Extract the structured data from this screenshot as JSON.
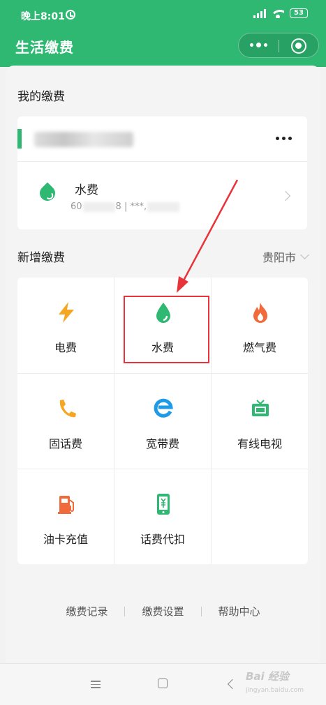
{
  "status_bar": {
    "time": "晚上8:01",
    "battery": "53"
  },
  "header": {
    "title": "生活缴费"
  },
  "my_bills": {
    "section_title": "我的缴费",
    "bill": {
      "title": "水费",
      "account_prefix": "60",
      "account_mid": "8 | ***,"
    }
  },
  "new_bills": {
    "section_title": "新增缴费",
    "city": "贵阳市",
    "items": [
      {
        "label": "电费",
        "icon": "lightning-icon",
        "color": "#f5a623"
      },
      {
        "label": "水费",
        "icon": "water-drop-icon",
        "color": "#2eb872"
      },
      {
        "label": "燃气费",
        "icon": "flame-icon",
        "color": "#f06a3b"
      },
      {
        "label": "固话费",
        "icon": "phone-icon",
        "color": "#f5a623"
      },
      {
        "label": "宽带费",
        "icon": "browser-e-icon",
        "color": "#1e9be8"
      },
      {
        "label": "有线电视",
        "icon": "tv-icon",
        "color": "#2eb872"
      },
      {
        "label": "油卡充值",
        "icon": "gas-pump-icon",
        "color": "#f06a3b"
      },
      {
        "label": "话费代扣",
        "icon": "mobile-yuan-icon",
        "color": "#2eb872"
      }
    ]
  },
  "footer": {
    "links": [
      "缴费记录",
      "缴费设置",
      "帮助中心"
    ]
  },
  "watermark": {
    "text": "Bai 经验",
    "sub": "jingyan.baidu.com"
  }
}
